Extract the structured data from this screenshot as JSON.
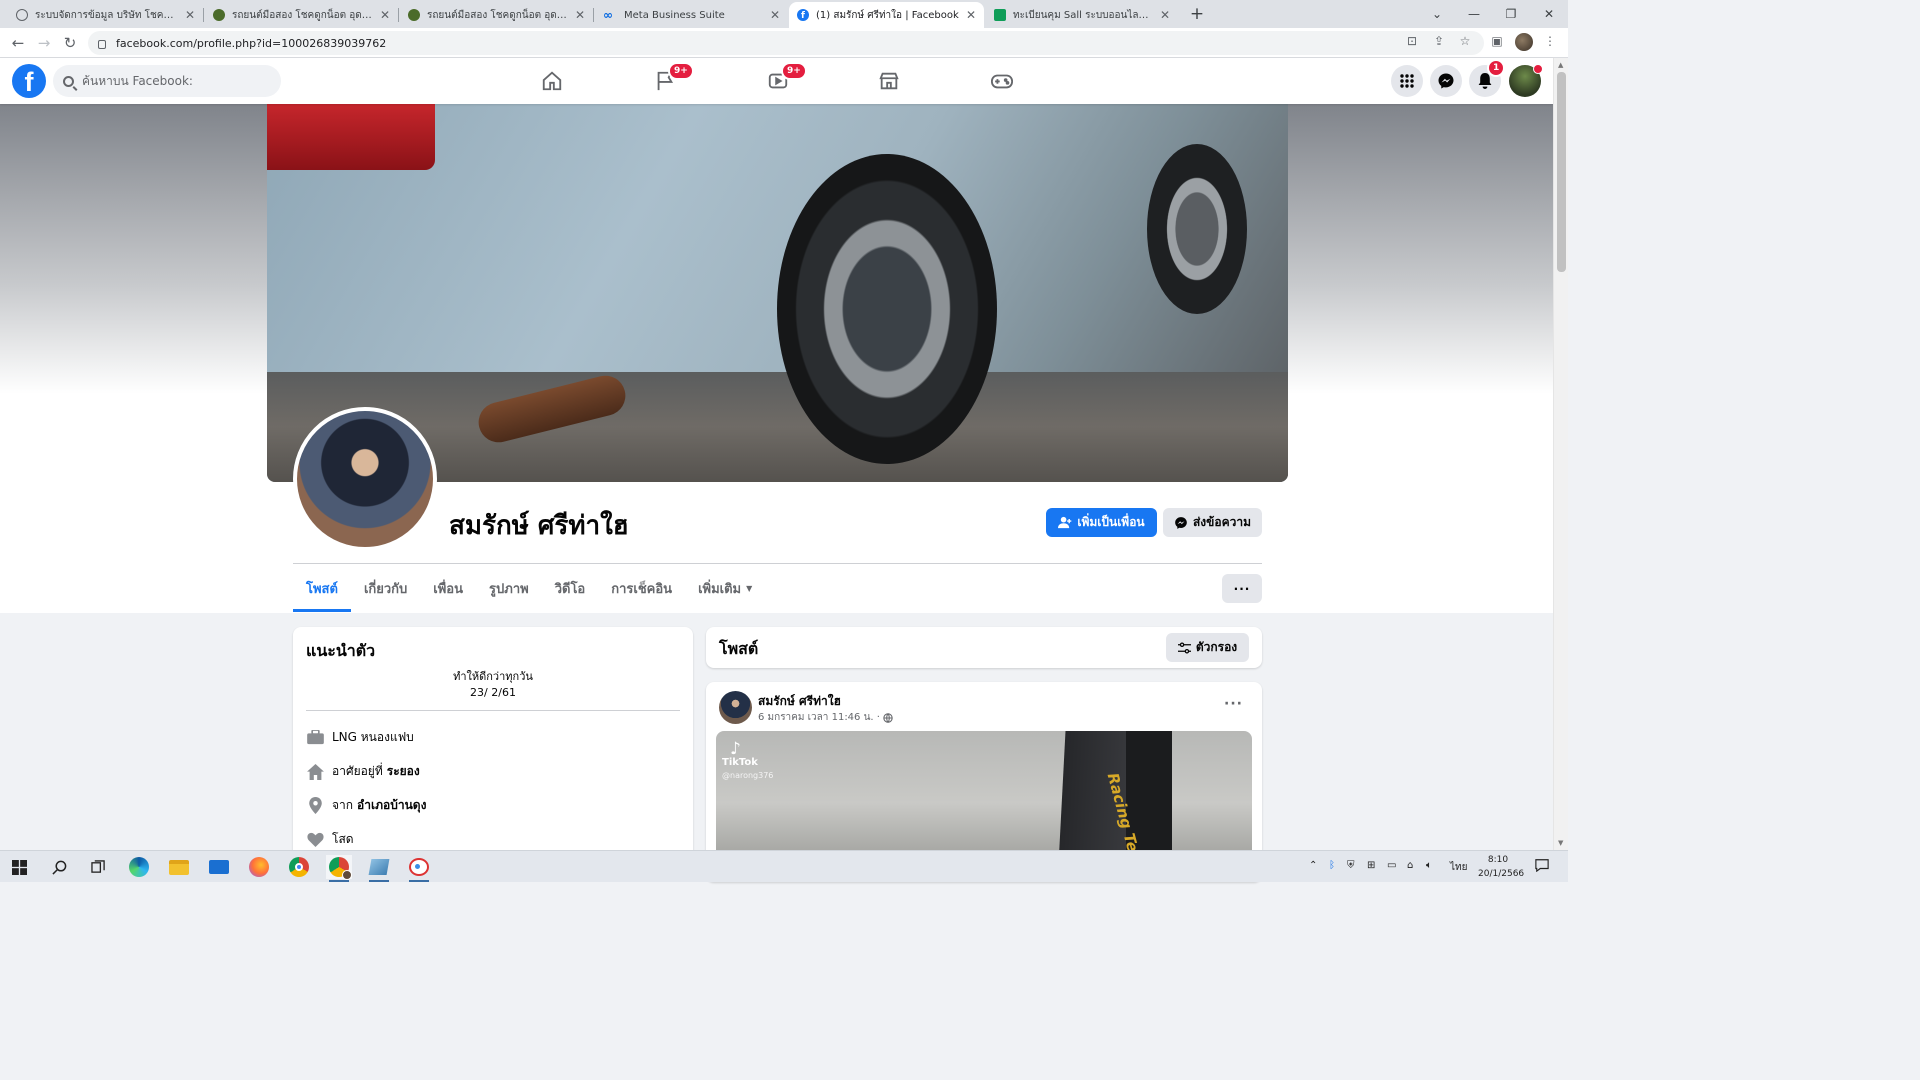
{
  "browser": {
    "tabs": [
      {
        "title": "ระบบจัดการข้อมูล บริษัท โชคดูกน็อต",
        "favicon": "globe-icon",
        "active": false
      },
      {
        "title": "รถยนต์มือสอง โชคดูกน็อต อุดรธานี",
        "favicon": "site-icon",
        "active": false
      },
      {
        "title": "รถยนต์มือสอง โชคดูกน็อต อุดรธานี",
        "favicon": "site-icon",
        "active": false
      },
      {
        "title": "Meta Business Suite",
        "favicon": "meta-icon",
        "active": false
      },
      {
        "title": "(1) สมรักษ์ ศรีท่าใอ | Facebook",
        "favicon": "facebook-icon",
        "active": true
      },
      {
        "title": "ทะเบียนคุม Sall ระบบออนไลน์.xlsx - G",
        "favicon": "sheets-icon",
        "active": false
      }
    ],
    "url": "facebook.com/profile.php?id=100026839039762"
  },
  "fb": {
    "search_placeholder": "ค้นหาบน Facebook:",
    "badges": {
      "pages": "9+",
      "watch": "9+",
      "notifications": "1"
    }
  },
  "profile": {
    "name": "สมรักษ์ ศรีท่าใฮ",
    "add_friend": "เพิ่มเป็นเพื่อน",
    "message": "ส่งข้อความ",
    "tabs": [
      "โพสต์",
      "เกี่ยวกับ",
      "เพื่อน",
      "รูปภาพ",
      "วิดีโอ",
      "การเช็คอิน",
      "เพิ่มเติม"
    ]
  },
  "intro": {
    "title": "แนะนำตัว",
    "bio_line1": "ทำให้ดีกว่าทุกวัน",
    "bio_line2": "23/ 2/61",
    "work": "LNG หนองแฟบ",
    "lives_prefix": "อาศัยอยู่ที่",
    "lives_place": "ระยอง",
    "from_prefix": "จาก",
    "from_place": "อำเภอบ้านดุง",
    "relationship": "โสด"
  },
  "posts": {
    "title": "โพสต์",
    "filter": "ตัวกรอง",
    "first": {
      "author": "สมรักษ์ ศรีท่าใฮ",
      "time": "6 มกราคม เวลา 11:46 น. ·",
      "tiktok_label": "TikTok",
      "tiktok_user": "@narong376",
      "banner_text": "Racing Team"
    }
  },
  "taskbar": {
    "lang": "ไทย",
    "time": "8:10",
    "date": "20/1/2566"
  },
  "colors": {
    "fb_blue": "#1877f2",
    "badge_red": "#e41e3f",
    "page_bg": "#f0f2f5"
  }
}
